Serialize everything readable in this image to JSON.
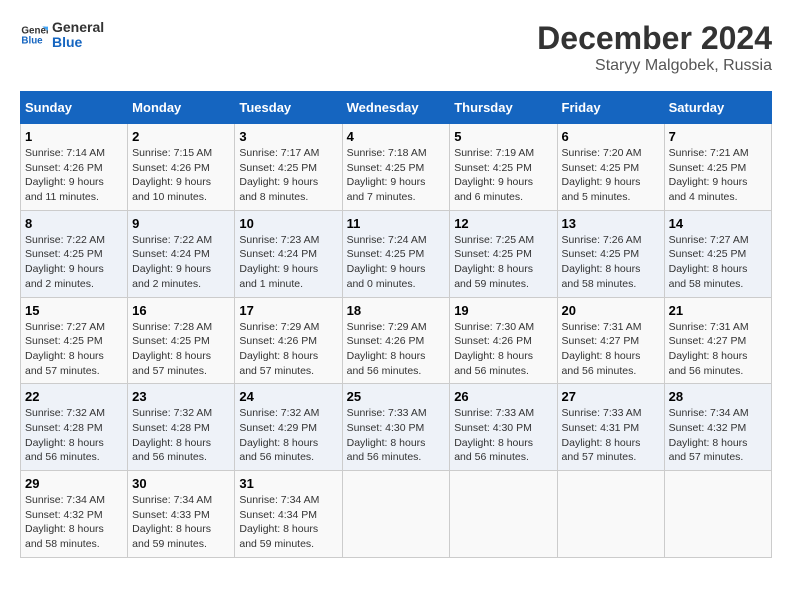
{
  "header": {
    "logo_general": "General",
    "logo_blue": "Blue",
    "title": "December 2024",
    "subtitle": "Staryy Malgobek, Russia"
  },
  "weekdays": [
    "Sunday",
    "Monday",
    "Tuesday",
    "Wednesday",
    "Thursday",
    "Friday",
    "Saturday"
  ],
  "weeks": [
    [
      {
        "day": "1",
        "sunrise": "7:14 AM",
        "sunset": "4:26 PM",
        "daylight": "9 hours and 11 minutes."
      },
      {
        "day": "2",
        "sunrise": "7:15 AM",
        "sunset": "4:26 PM",
        "daylight": "9 hours and 10 minutes."
      },
      {
        "day": "3",
        "sunrise": "7:17 AM",
        "sunset": "4:25 PM",
        "daylight": "9 hours and 8 minutes."
      },
      {
        "day": "4",
        "sunrise": "7:18 AM",
        "sunset": "4:25 PM",
        "daylight": "9 hours and 7 minutes."
      },
      {
        "day": "5",
        "sunrise": "7:19 AM",
        "sunset": "4:25 PM",
        "daylight": "9 hours and 6 minutes."
      },
      {
        "day": "6",
        "sunrise": "7:20 AM",
        "sunset": "4:25 PM",
        "daylight": "9 hours and 5 minutes."
      },
      {
        "day": "7",
        "sunrise": "7:21 AM",
        "sunset": "4:25 PM",
        "daylight": "9 hours and 4 minutes."
      }
    ],
    [
      {
        "day": "8",
        "sunrise": "7:22 AM",
        "sunset": "4:25 PM",
        "daylight": "9 hours and 2 minutes."
      },
      {
        "day": "9",
        "sunrise": "7:22 AM",
        "sunset": "4:24 PM",
        "daylight": "9 hours and 2 minutes."
      },
      {
        "day": "10",
        "sunrise": "7:23 AM",
        "sunset": "4:24 PM",
        "daylight": "9 hours and 1 minute."
      },
      {
        "day": "11",
        "sunrise": "7:24 AM",
        "sunset": "4:25 PM",
        "daylight": "9 hours and 0 minutes."
      },
      {
        "day": "12",
        "sunrise": "7:25 AM",
        "sunset": "4:25 PM",
        "daylight": "8 hours and 59 minutes."
      },
      {
        "day": "13",
        "sunrise": "7:26 AM",
        "sunset": "4:25 PM",
        "daylight": "8 hours and 58 minutes."
      },
      {
        "day": "14",
        "sunrise": "7:27 AM",
        "sunset": "4:25 PM",
        "daylight": "8 hours and 58 minutes."
      }
    ],
    [
      {
        "day": "15",
        "sunrise": "7:27 AM",
        "sunset": "4:25 PM",
        "daylight": "8 hours and 57 minutes."
      },
      {
        "day": "16",
        "sunrise": "7:28 AM",
        "sunset": "4:25 PM",
        "daylight": "8 hours and 57 minutes."
      },
      {
        "day": "17",
        "sunrise": "7:29 AM",
        "sunset": "4:26 PM",
        "daylight": "8 hours and 57 minutes."
      },
      {
        "day": "18",
        "sunrise": "7:29 AM",
        "sunset": "4:26 PM",
        "daylight": "8 hours and 56 minutes."
      },
      {
        "day": "19",
        "sunrise": "7:30 AM",
        "sunset": "4:26 PM",
        "daylight": "8 hours and 56 minutes."
      },
      {
        "day": "20",
        "sunrise": "7:31 AM",
        "sunset": "4:27 PM",
        "daylight": "8 hours and 56 minutes."
      },
      {
        "day": "21",
        "sunrise": "7:31 AM",
        "sunset": "4:27 PM",
        "daylight": "8 hours and 56 minutes."
      }
    ],
    [
      {
        "day": "22",
        "sunrise": "7:32 AM",
        "sunset": "4:28 PM",
        "daylight": "8 hours and 56 minutes."
      },
      {
        "day": "23",
        "sunrise": "7:32 AM",
        "sunset": "4:28 PM",
        "daylight": "8 hours and 56 minutes."
      },
      {
        "day": "24",
        "sunrise": "7:32 AM",
        "sunset": "4:29 PM",
        "daylight": "8 hours and 56 minutes."
      },
      {
        "day": "25",
        "sunrise": "7:33 AM",
        "sunset": "4:30 PM",
        "daylight": "8 hours and 56 minutes."
      },
      {
        "day": "26",
        "sunrise": "7:33 AM",
        "sunset": "4:30 PM",
        "daylight": "8 hours and 56 minutes."
      },
      {
        "day": "27",
        "sunrise": "7:33 AM",
        "sunset": "4:31 PM",
        "daylight": "8 hours and 57 minutes."
      },
      {
        "day": "28",
        "sunrise": "7:34 AM",
        "sunset": "4:32 PM",
        "daylight": "8 hours and 57 minutes."
      }
    ],
    [
      {
        "day": "29",
        "sunrise": "7:34 AM",
        "sunset": "4:32 PM",
        "daylight": "8 hours and 58 minutes."
      },
      {
        "day": "30",
        "sunrise": "7:34 AM",
        "sunset": "4:33 PM",
        "daylight": "8 hours and 59 minutes."
      },
      {
        "day": "31",
        "sunrise": "7:34 AM",
        "sunset": "4:34 PM",
        "daylight": "8 hours and 59 minutes."
      },
      null,
      null,
      null,
      null
    ]
  ]
}
